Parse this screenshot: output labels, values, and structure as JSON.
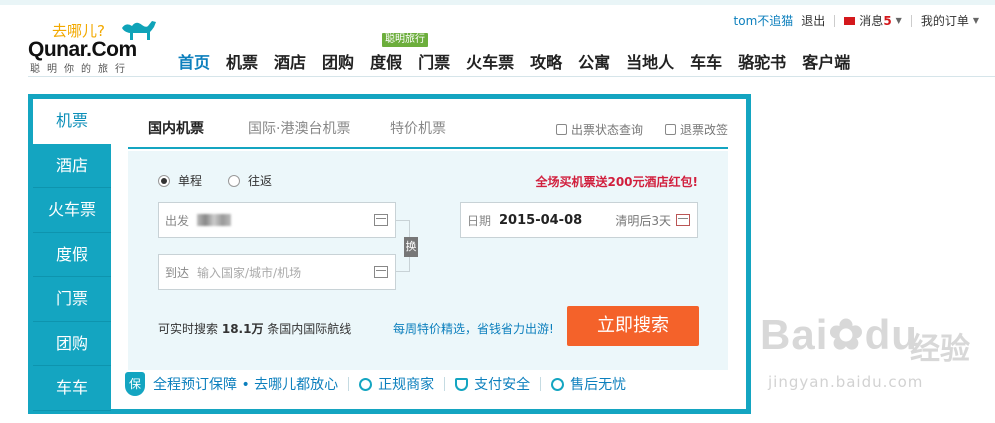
{
  "brand": {
    "logo_cn": "去哪儿?",
    "logo_en": "Qunar.Com",
    "slogan": "聪明你的旅行"
  },
  "user_bar": {
    "username": "tom不追猫",
    "logout": "退出",
    "messages_label": "消息",
    "messages_count": "5",
    "orders": "我的订单"
  },
  "nav": {
    "items": [
      "首页",
      "机票",
      "酒店",
      "团购",
      "度假",
      "门票",
      "火车票",
      "攻略",
      "公寓",
      "当地人",
      "车车",
      "骆驼书",
      "客户端"
    ],
    "active_index": 0,
    "badge": "聪明旅行"
  },
  "side": {
    "items": [
      "机票",
      "酒店",
      "火车票",
      "度假",
      "门票",
      "团购",
      "车车"
    ],
    "active_index": 0
  },
  "tabs": {
    "domestic": "国内机票",
    "international": "国际·港澳台机票",
    "special": "特价机票",
    "status": "出票状态查询",
    "refund": "退票改签"
  },
  "form": {
    "one_way": "单程",
    "round_trip": "往返",
    "promo": "全场买机票送200元酒店红包!",
    "from_label": "出发",
    "to_label": "到达",
    "to_placeholder": "输入国家/城市/机场",
    "swap": "换",
    "date_label": "日期",
    "date_value": "2015-04-08",
    "date_hint": "清明后3天",
    "stat_prefix": "可实时搜索",
    "stat_value": "18.1万",
    "stat_suffix": "条国内国际航线",
    "weekly": "每周特价精选，省钱省力出游!",
    "search_button": "立即搜索"
  },
  "guarantee": {
    "shield": "保",
    "main": "全程预订保障 • 去哪儿都放心",
    "item1": "正规商家",
    "item2": "支付安全",
    "item3": "售后无忧"
  },
  "watermark": {
    "main": "Bai",
    "main2": "du",
    "cn": "经验",
    "url": "jingyan.baidu.com"
  },
  "colors": {
    "accent": "#14a5c1",
    "button": "#f4622a",
    "promo": "#d11f3d"
  }
}
